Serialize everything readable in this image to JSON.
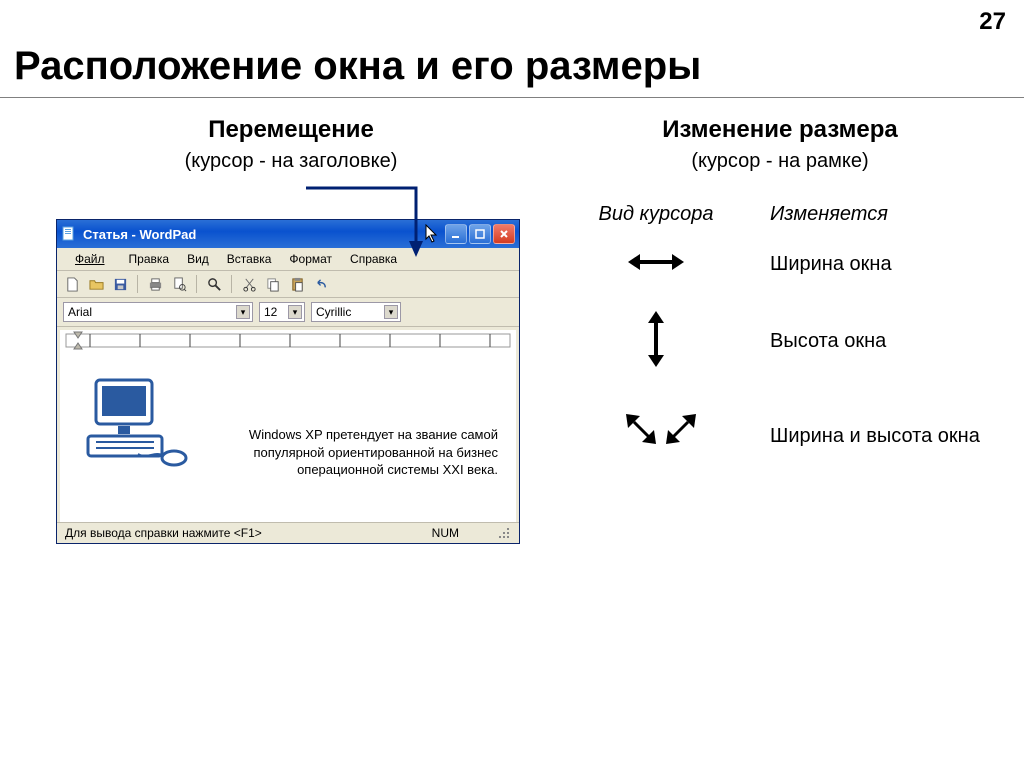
{
  "page_number": "27",
  "title": "Расположение окна и его размеры",
  "left": {
    "header": "Перемещение",
    "caption": "(курсор - на заголовке)"
  },
  "right": {
    "header": "Изменение размера",
    "caption": "(курсор - на рамке)",
    "table_head_a": "Вид курсора",
    "table_head_b": "Изменяется",
    "row1": "Ширина окна",
    "row2": "Высота окна",
    "row3": "Ширина и высота окна"
  },
  "wordpad": {
    "title": "Статья - WordPad",
    "menu": {
      "file": "Файл",
      "edit": "Правка",
      "view": "Вид",
      "insert": "Вставка",
      "format": "Формат",
      "help": "Справка"
    },
    "font": "Arial",
    "size": "12",
    "script": "Cyrillic",
    "body": "Windows XP претендует на звание самой популярной ориентированной на бизнес операционной системы XXI века.",
    "status": "Для вывода справки нажмите <F1>",
    "num": "NUM"
  }
}
